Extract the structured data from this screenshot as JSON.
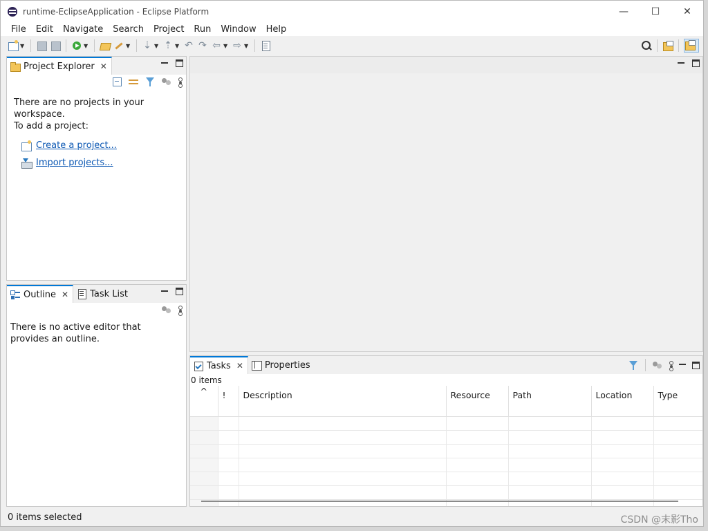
{
  "window": {
    "title": "runtime-EclipseApplication - Eclipse Platform",
    "minimize": "—",
    "maximize": "☐",
    "close": "✕"
  },
  "menu": [
    "File",
    "Edit",
    "Navigate",
    "Search",
    "Project",
    "Run",
    "Window",
    "Help"
  ],
  "project_explorer": {
    "tab_label": "Project Explorer",
    "message_line1": "There are no projects in your workspace.",
    "message_line2": "To add a project:",
    "create_link": "Create a project...",
    "import_link": "Import projects..."
  },
  "outline_panel": {
    "outline_tab": "Outline",
    "tasklist_tab": "Task List",
    "message": "There is no active editor that provides an outline."
  },
  "tasks_panel": {
    "tasks_tab": "Tasks",
    "properties_tab": "Properties",
    "count": "0 items",
    "sort_indicator": "^",
    "columns": [
      "!",
      "Description",
      "Resource",
      "Path",
      "Location",
      "Type"
    ]
  },
  "status": {
    "selection": "0 items selected"
  },
  "watermark": "CSDN @末影Tho"
}
